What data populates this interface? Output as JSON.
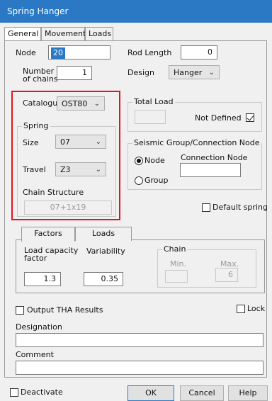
{
  "window": {
    "title": "Spring Hanger"
  },
  "tabs": [
    "General",
    "Movements",
    "Loads"
  ],
  "general": {
    "node_label": "Node",
    "node_value": "20",
    "rod_length_label": "Rod Length",
    "rod_length_value": "0",
    "chains_label_1": "Number",
    "chains_label_2": "of chains",
    "chains_value": "1",
    "design_label": "Design",
    "design_value": "Hanger",
    "catalogue_label": "Catalogue",
    "catalogue_value": "OST80",
    "spring_group": "Spring",
    "size_label": "Size",
    "size_value": "07",
    "travel_label": "Travel",
    "travel_value": "Z3",
    "chain_structure_label": "Chain Structure",
    "chain_structure_value": "07+1x19",
    "total_load_group": "Total Load",
    "not_defined_label": "Not Defined",
    "seismic_group": "Seismic Group/Connection Node",
    "node_radio": "Node",
    "group_radio": "Group",
    "connection_node_label": "Connection Node",
    "default_spring_label": "Default spring"
  },
  "subtabs": [
    "Factors",
    "Loads"
  ],
  "factors": {
    "load_capacity_label_1": "Load capacity",
    "load_capacity_label_2": "factor",
    "load_capacity_value": "1.3",
    "variability_label": "Variability",
    "variability_value": "0.35",
    "chain_group": "Chain",
    "min_label": "Min.",
    "max_label": "Max.",
    "max_value": "6"
  },
  "lower": {
    "output_tha_label": "Output THA Results",
    "lock_label": "Lock",
    "designation_label": "Designation",
    "comment_label": "Comment"
  },
  "footer": {
    "deactivate_label": "Deactivate",
    "ok": "OK",
    "cancel": "Cancel",
    "help": "Help"
  },
  "colors": {
    "titlebar": "#2b78c5",
    "highlight_box": "#e8141c"
  }
}
